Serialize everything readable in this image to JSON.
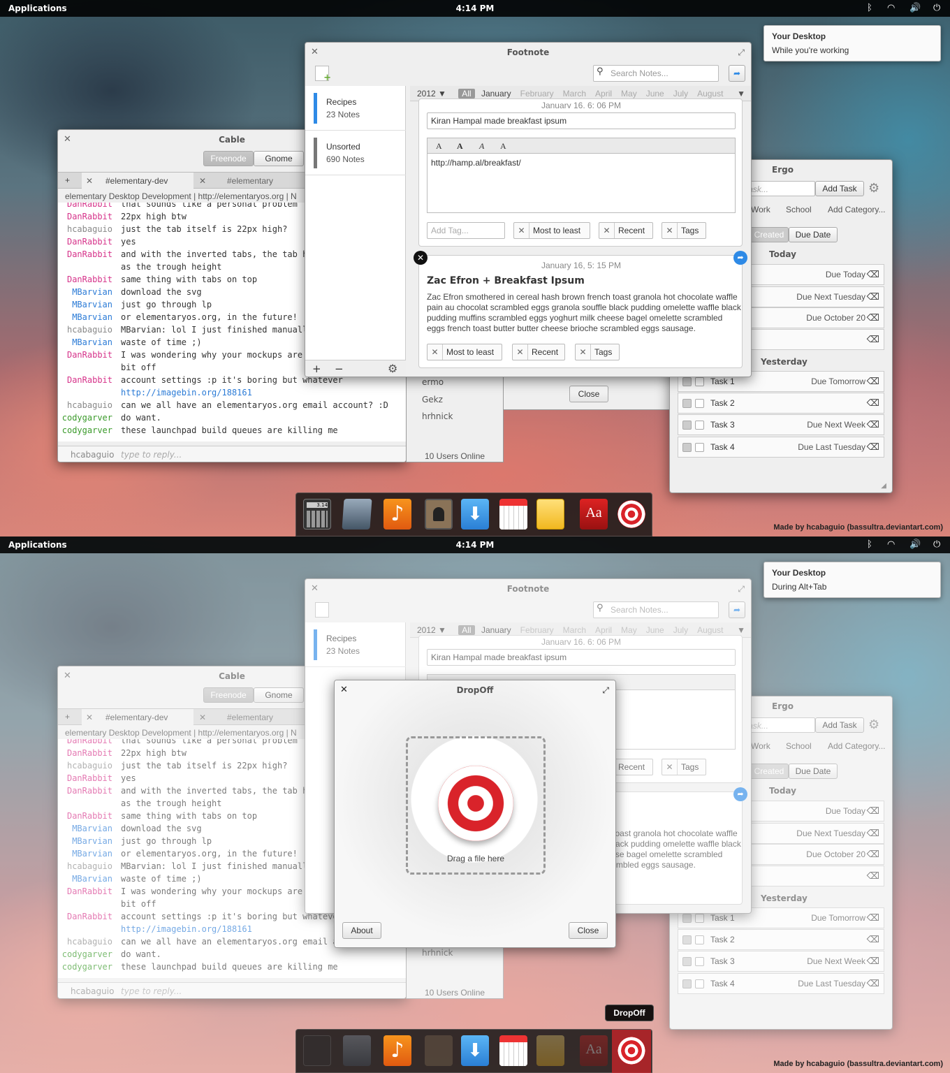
{
  "panel": {
    "applications": "Applications",
    "clock": "4:14 PM",
    "bluetooth_icon": "bluetooth-icon",
    "wifi_icon": "wifi-icon",
    "volume_icon": "volume-icon",
    "power_icon": "power-icon"
  },
  "notifications": [
    {
      "title": "Your Desktop",
      "body": "While you're working"
    },
    {
      "title": "Your Desktop",
      "body": "During Alt+Tab"
    }
  ],
  "cable": {
    "title": "Cable",
    "networks": [
      "Freenode",
      "Gnome"
    ],
    "tabs": [
      "#elementary-dev",
      "#elementary"
    ],
    "topic": "elementary Desktop Development | http://elementaryos.org | N",
    "lines": [
      {
        "nick": "DanRabbit",
        "cls": "pink",
        "msg": "that sounds like a personal problem"
      },
      {
        "nick": "DanRabbit",
        "cls": "pink",
        "msg": "22px high btw"
      },
      {
        "nick": "hcabaguio",
        "cls": "gray",
        "msg": "just the tab itself is 22px high?"
      },
      {
        "nick": "DanRabbit",
        "cls": "pink",
        "msg": "yes"
      },
      {
        "nick": "DanRabbit",
        "cls": "pink",
        "msg": "and with the inverted tabs, the tab h"
      },
      {
        "nick": "",
        "cls": "gray",
        "msg": "as the trough height"
      },
      {
        "nick": "DanRabbit",
        "cls": "pink",
        "msg": "same thing with tabs on top"
      },
      {
        "nick": "MBarvian",
        "cls": "blue",
        "msg": "download the svg"
      },
      {
        "nick": "MBarvian",
        "cls": "blue",
        "msg": "just go through lp"
      },
      {
        "nick": "MBarvian",
        "cls": "blue",
        "msg": "or elementaryos.org, in the future!"
      },
      {
        "nick": "hcabaguio",
        "cls": "gray",
        "msg": "MBarvian: lol I just finished manuall"
      },
      {
        "nick": "MBarvian",
        "cls": "blue",
        "msg": "waste of time ;)"
      },
      {
        "nick": "DanRabbit",
        "cls": "pink",
        "msg": "I was wondering why your mockups are"
      },
      {
        "nick": "",
        "cls": "gray",
        "msg": "bit off"
      },
      {
        "nick": "DanRabbit",
        "cls": "pink",
        "msg": "account settings :p it's boring but whatever"
      },
      {
        "nick": "",
        "cls": "gray",
        "msg": "http://imagebin.org/188161"
      },
      {
        "nick": "hcabaguio",
        "cls": "gray",
        "msg": "can we all have an elementaryos.org email account? :D"
      },
      {
        "nick": "codygarver",
        "cls": "green",
        "msg": "do want."
      },
      {
        "nick": "codygarver",
        "cls": "green",
        "msg": "these launchpad build queues are killing me"
      }
    ],
    "reply_nick": "hcabaguio",
    "reply_placeholder": "type to reply...",
    "users": [
      "ermo",
      "Gekz",
      "hrhnick"
    ],
    "users_online": "10 Users Online",
    "close": "Close"
  },
  "footnote": {
    "title": "Footnote",
    "search_placeholder": "Search Notes...",
    "year": "2012 ▼",
    "all": "All",
    "months": [
      "January",
      "February",
      "March",
      "April",
      "May",
      "June",
      "July",
      "August"
    ],
    "notebooks": [
      {
        "name": "Recipes",
        "count": "23 Notes"
      },
      {
        "name": "Unsorted",
        "count": "690 Notes"
      }
    ],
    "note1": {
      "date": "January 16, 6: 06 PM",
      "title": "Kiran Hampal made breakfast ipsum",
      "fmt": [
        "A",
        "A",
        "A",
        "A"
      ],
      "body": "http://hamp.al/breakfast/",
      "add_tag": "Add Tag...",
      "tags": [
        "Most to least",
        "Recent",
        "Tags"
      ]
    },
    "note2": {
      "date": "January 16, 5: 15 PM",
      "title": "Zac Efron + Breakfast Ipsum",
      "body": "Zac Efron smothered in cereal hash brown french toast granola hot chocolate waffle pain au chocolat scrambled eggs granola souffle black pudding omelette waffle black pudding muffins scrambled eggs yoghurt milk cheese bagel omelette scrambled eggs french toast butter butter cheese brioche scrambled eggs sausage.",
      "tags": [
        "Most to least",
        "Recent",
        "Tags"
      ]
    }
  },
  "ergo": {
    "title": "Ergo",
    "task_placeholder": "Task...",
    "add_task": "Add Task",
    "categories": [
      "Work",
      "School",
      "Add Category..."
    ],
    "sort": [
      "Created",
      "Due Date"
    ],
    "today": "Today",
    "yesterday": "Yesterday",
    "today_tasks": [
      "Due Today",
      "Due Next Tuesday",
      "Due October 20",
      ""
    ],
    "tasks": [
      {
        "name": "Task 1",
        "due": "Due Tomorrow"
      },
      {
        "name": "Task 2",
        "due": ""
      },
      {
        "name": "Task 3",
        "due": "Due Next Week"
      },
      {
        "name": "Task 4",
        "due": "Due Last Tuesday"
      }
    ]
  },
  "dropoff": {
    "title": "DropOff",
    "hint": "Drag a file here",
    "about": "About",
    "close": "Close",
    "tooltip": "DropOff"
  },
  "dock": {
    "items": [
      "calculator-icon",
      "text-editor-icon",
      "music-icon",
      "contacts-icon",
      "download-icon",
      "calendar-icon",
      "mail-icon",
      "dictionary-icon",
      "dropoff-icon"
    ],
    "dictionary_label": "Aa",
    "calc_label": "3.14"
  },
  "credit": "Made by hcabaguio (bassultra.deviantart.com)",
  "colors": {
    "accent": "#2e8ae6",
    "dropoff_red": "#d9232a",
    "panel": "#000000"
  }
}
